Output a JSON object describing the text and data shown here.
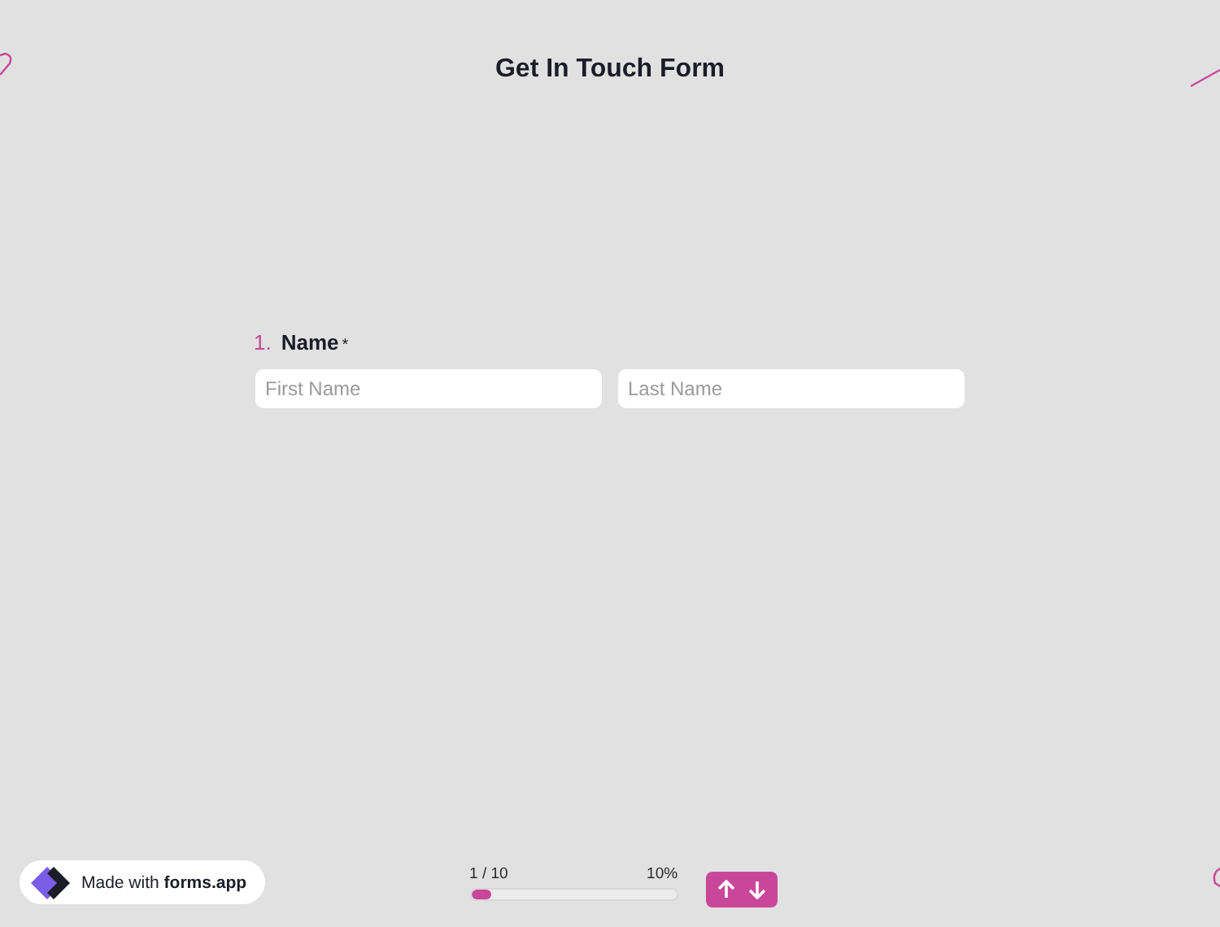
{
  "title": "Get In Touch Form",
  "question": {
    "number": "1.",
    "label": "Name",
    "required_mark": "*",
    "fields": [
      {
        "placeholder": "First Name"
      },
      {
        "placeholder": "Last Name"
      }
    ]
  },
  "footer": {
    "badge": "Made with **forms.app**",
    "progress": {
      "step": "1 / 10",
      "percent": "10%",
      "level": 0.1
    }
  }
}
